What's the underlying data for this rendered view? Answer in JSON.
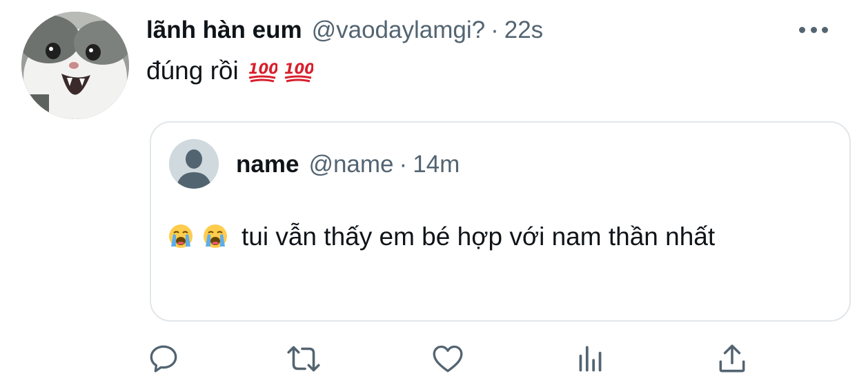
{
  "tweet": {
    "display_name": "lãnh hàn eum",
    "handle": "@vaodaylamgi?",
    "separator": "·",
    "time": "22s",
    "text": "đúng rồi",
    "emojis": [
      "hundred-points-emoji",
      "hundred-points-emoji"
    ]
  },
  "quoted": {
    "display_name": "name",
    "handle": "@name",
    "separator": "·",
    "time": "14m",
    "emojis": [
      "loudly-crying-face-emoji",
      "loudly-crying-face-emoji"
    ],
    "text": "tui vẫn thấy em bé hợp với nam thần nhất"
  },
  "actions": [
    {
      "name": "reply-icon"
    },
    {
      "name": "retweet-icon"
    },
    {
      "name": "like-icon"
    },
    {
      "name": "analytics-icon"
    },
    {
      "name": "share-icon"
    }
  ],
  "colors": {
    "text": "#0f1419",
    "secondary": "#536471",
    "border": "#e1e6ea",
    "icon": "#536471"
  }
}
